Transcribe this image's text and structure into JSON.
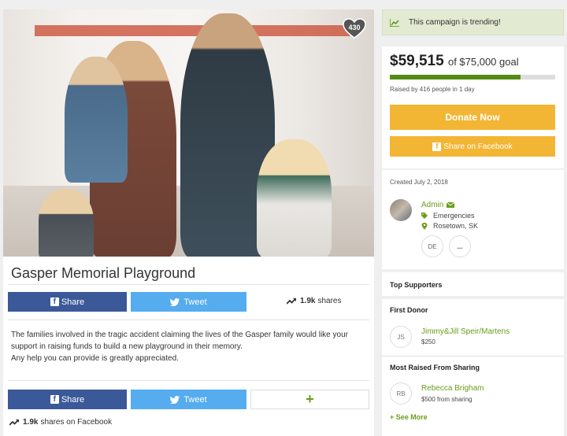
{
  "campaign": {
    "title": "Gasper Memorial Playground",
    "favorites_count": "430",
    "description": [
      "The families involved in the tragic accident claiming the lives of the Gasper family would like your",
      "support in raising funds to build a new playground in their memory.",
      "Any help you can provide is greatly appreciated."
    ]
  },
  "share_top": {
    "share_label": "Share",
    "tweet_label": "Tweet",
    "count": "1.9k",
    "count_suffix": "shares"
  },
  "share_bottom": {
    "share_label": "Share",
    "tweet_label": "Tweet",
    "plus_label": "+",
    "count": "1.9k",
    "count_suffix": "shares on Facebook"
  },
  "sidebar": {
    "trending_text": "This campaign is trending!",
    "raised_amount": "$59,515",
    "goal_text": "of $75,000 goal",
    "progress_fraction": 0.79,
    "raised_by": "Raised by 416 people in 1 day",
    "donate_label": "Donate Now",
    "share_fb_label": "Share on Facebook",
    "created": "Created July 2, 2018",
    "organizer": {
      "name": "Admin",
      "category": "Emergencies",
      "location": "Rosetown, SK",
      "badge_initials": "DE",
      "more_label": "..."
    },
    "top_supporters_title": "Top Supporters",
    "first_donor_title": "First Donor",
    "first_donor": {
      "initials": "JS",
      "name": "Jimmy&Jill Speir/Martens",
      "amount": "$250"
    },
    "most_raised_title": "Most Raised From Sharing",
    "top_sharer": {
      "initials": "RB",
      "name": "Rebecca Brigham",
      "amount": "$500 from sharing"
    },
    "see_more_label": "+ See More"
  },
  "colors": {
    "accent_green": "#6a9e19",
    "donate_orange": "#f3b534",
    "facebook_blue": "#3b5998",
    "twitter_blue": "#55acee"
  }
}
